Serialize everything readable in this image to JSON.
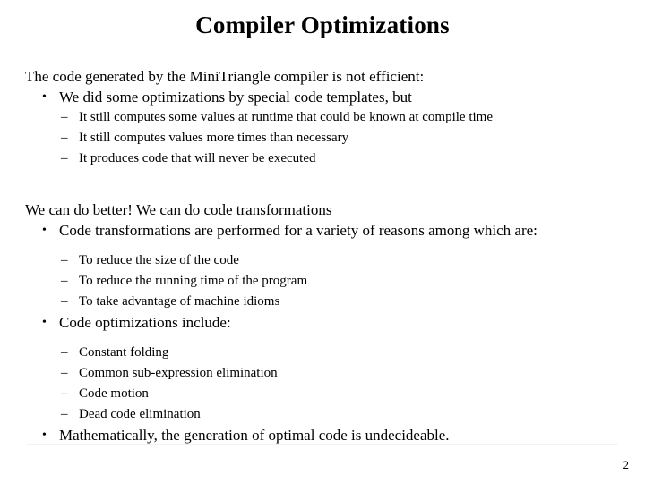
{
  "slide": {
    "title": "Compiler Optimizations",
    "page_number": "2",
    "sections": [
      {
        "intro": "The code generated by the MiniTriangle compiler is not efficient:",
        "bullet": "We did some optimizations by special code templates, but",
        "subitems": [
          "It still computes some values at runtime that could be known at compile time",
          "It still computes values more times than necessary",
          "It produces code that will never be executed"
        ]
      },
      {
        "intro": "We can do better! We can do code transformations",
        "bullet": "Code transformations are performed for a variety of reasons among which are:",
        "subitems": [
          "To reduce the size of the code",
          "To reduce the running time of the program",
          "To take advantage of machine idioms"
        ]
      },
      {
        "bullet": "Code optimizations include:",
        "subitems": [
          "Constant folding",
          "Common sub-expression elimination",
          "Code motion",
          "Dead code elimination"
        ]
      },
      {
        "bullet": "Mathematically, the generation of optimal code is undecideable."
      }
    ],
    "markers": {
      "bullet_glyph": "•",
      "dash_glyph": "–"
    },
    "colors": {
      "text": "#000000",
      "background": "#ffffff",
      "footer_rule": "#f2f2f2"
    }
  }
}
